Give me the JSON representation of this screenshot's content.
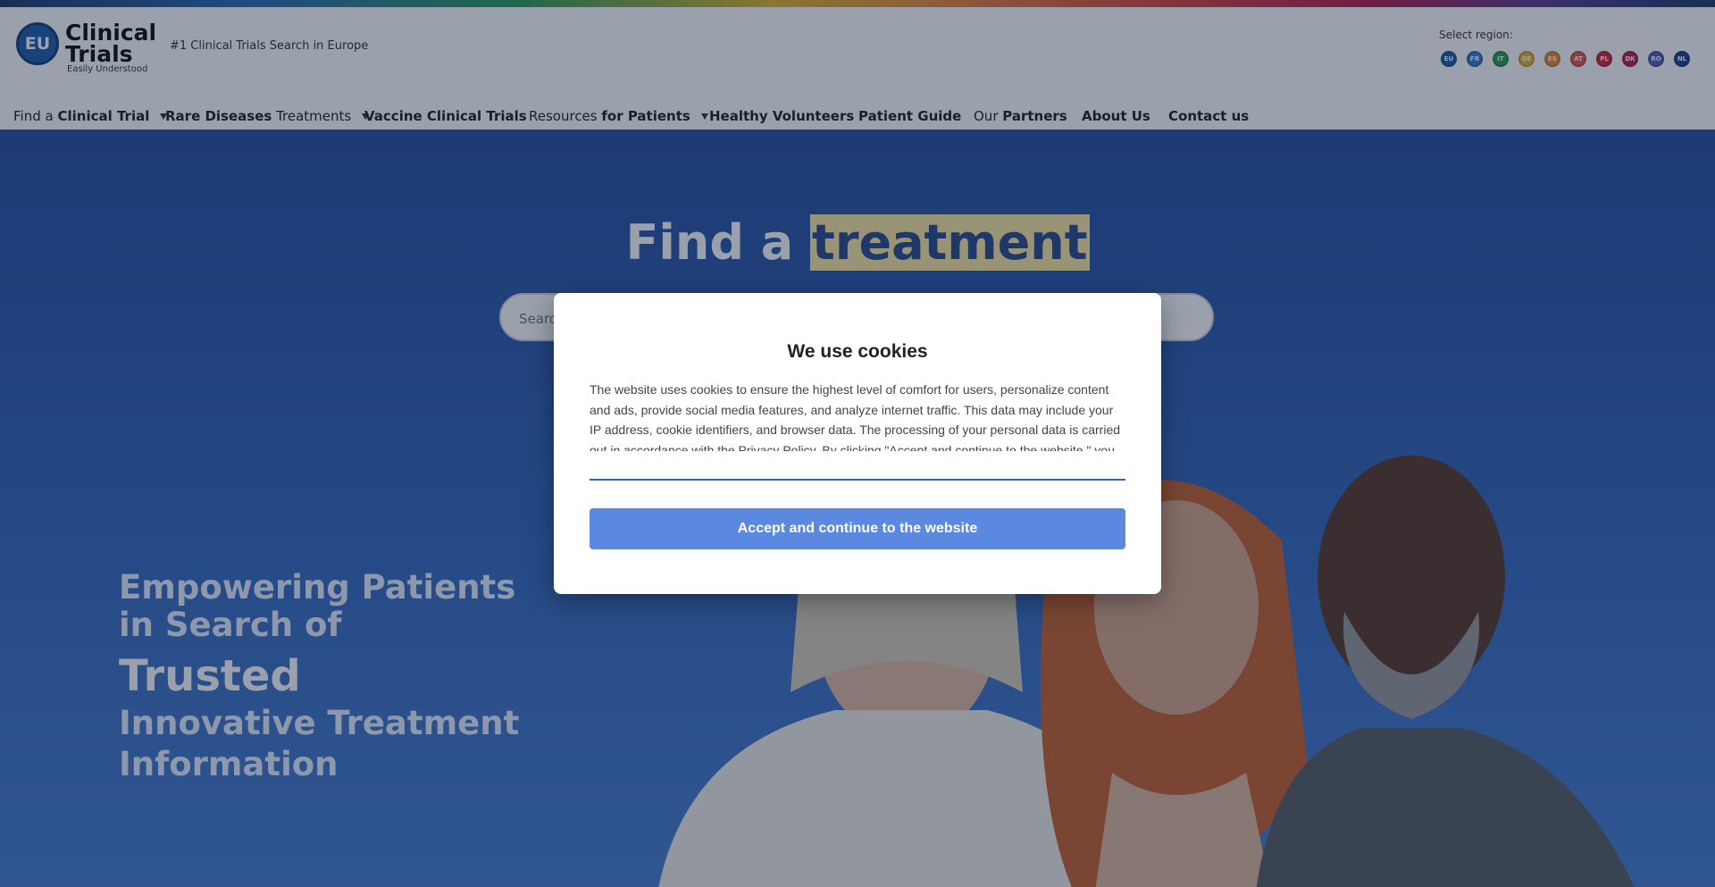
{
  "brand": {
    "logo_badge": "EU",
    "logo_title_line1": "Clinical",
    "logo_title_line2": "Trials",
    "logo_subtitle": "Easily Understood",
    "tagline": "#1 Clinical Trials Search in Europe"
  },
  "regions": {
    "label": "Select region:",
    "items": [
      {
        "code": "EU",
        "color": "#1f5ea8"
      },
      {
        "code": "FR",
        "color": "#3a7cc4"
      },
      {
        "code": "IT",
        "color": "#2f9a4e"
      },
      {
        "code": "DE",
        "color": "#e4b832"
      },
      {
        "code": "ES",
        "color": "#e98a3c"
      },
      {
        "code": "AT",
        "color": "#e05a4f"
      },
      {
        "code": "PL",
        "color": "#d8243b"
      },
      {
        "code": "DK",
        "color": "#c02247"
      },
      {
        "code": "RO",
        "color": "#5560b0"
      },
      {
        "code": "NL",
        "color": "#22408a"
      }
    ]
  },
  "nav": {
    "find_pre": "Find a ",
    "find_bold": "Clinical Trial",
    "rare_bold": "Rare Diseases",
    "rare_post": " Treatments",
    "vaccine": "Vaccine Clinical Trials",
    "resources_pre": "Resources ",
    "resources_bold": "for Patients",
    "healthy": "Healthy Volunteers",
    "guide": "Patient Guide",
    "partners_pre": "Our ",
    "partners_bold": "Partners",
    "about": "About Us",
    "contact": "Contact us"
  },
  "hero": {
    "title_pre": "Find a ",
    "title_highlight": "treatment",
    "search_placeholder": "Search",
    "empower_line1": "Empowering Patients",
    "empower_line2": "in Search of",
    "empower_word": "Trusted",
    "empower_line3": "Innovative Treatment",
    "empower_line4": "Information"
  },
  "cookie_modal": {
    "title": "We use cookies",
    "body": "The website uses cookies to ensure the highest level of comfort for users, personalize content and ads, provide social media features, and analyze internet traffic. This data may include your IP address, cookie identifiers, and browser data. The processing of your personal data is carried out in accordance with the Privacy Policy. By clicking \"Accept and continue to the website,\" you",
    "accept_label": "Accept and continue to the website"
  }
}
